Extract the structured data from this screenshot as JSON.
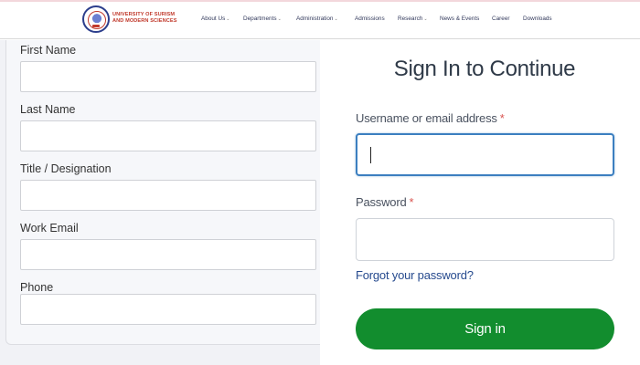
{
  "header": {
    "logo_line1": "UNIVERSITY OF SURISM",
    "logo_line2": "AND MODERN SCIENCES",
    "nav": [
      {
        "label": "About Us",
        "has_menu": true
      },
      {
        "label": "Departments",
        "has_menu": true
      },
      {
        "label": "Administration",
        "has_menu": true
      },
      {
        "label": "Admissions",
        "has_menu": false
      },
      {
        "label": "Research",
        "has_menu": true
      },
      {
        "label": "News & Events",
        "has_menu": false
      },
      {
        "label": "Career",
        "has_menu": false
      },
      {
        "label": "Downloads",
        "has_menu": false
      }
    ]
  },
  "form": {
    "fields": [
      {
        "label": "First Name",
        "value": ""
      },
      {
        "label": "Last Name",
        "value": ""
      },
      {
        "label": "Title / Designation",
        "value": ""
      },
      {
        "label": "Work Email",
        "value": ""
      },
      {
        "label": "Phone",
        "value": ""
      }
    ]
  },
  "signin": {
    "title": "Sign In to Continue",
    "username_label": "Username or email address",
    "username_value": "",
    "password_label": "Password",
    "password_value": "",
    "required_mark": "*",
    "forgot_label": "Forgot your password?",
    "button_label": "Sign in"
  },
  "colors": {
    "primary_button": "#128d2e",
    "link": "#264a8e",
    "focus_border": "#3c7fc0",
    "required": "#d9534f",
    "logo_text": "#c0392b"
  }
}
